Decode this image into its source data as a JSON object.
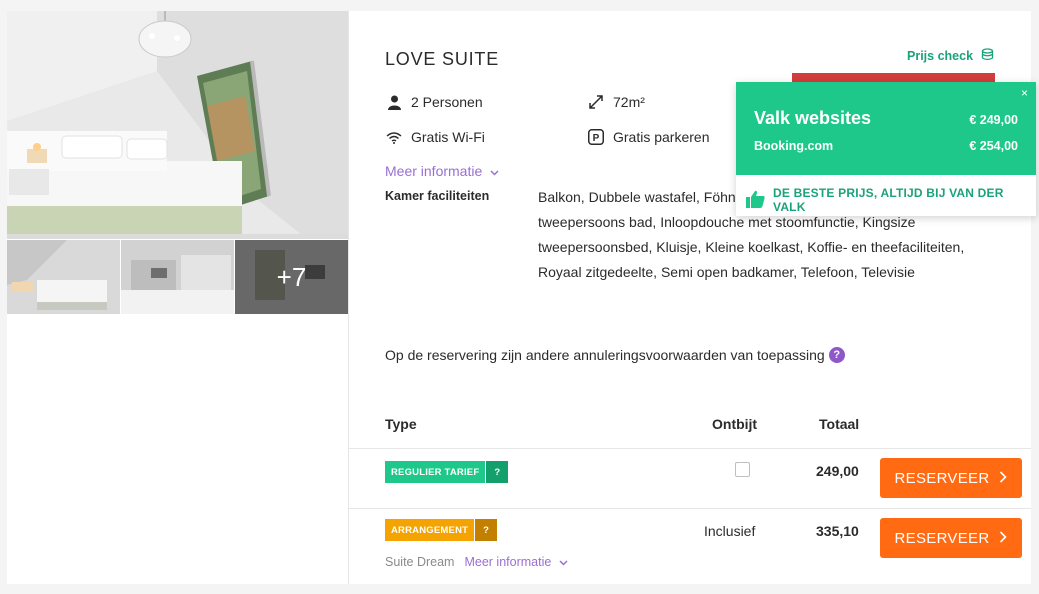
{
  "room": {
    "title": "LOVE SUITE",
    "features": {
      "persons": "2 Personen",
      "size": "72m²",
      "wifi": "Gratis Wi-Fi",
      "parking": "Gratis parkeren"
    },
    "more_info": "Meer informatie",
    "facilities_label": "Kamer faciliteiten",
    "facilities_text": "Balkon, Dubbele wastafel, Föhn, Bluetooth audio systeem, Groot tweepersoons bad, Inloopdouche met stoomfunctie, Kingsize tweepersoonsbed, Kluisje, Kleine koelkast, Koffie- en theefaciliteiten, Royaal zitgedeelte, Semi open badkamer, Telefoon, Televisie",
    "cancel_note": "Op de reservering zijn andere annuleringsvoorwaarden van toepassing",
    "more_photos": "+7"
  },
  "price_check": {
    "label": "Prijs check",
    "close": "×",
    "rows": [
      {
        "name": "Valk websites",
        "price": "€ 249,00"
      },
      {
        "name": "Booking.com",
        "price": "€ 254,00"
      }
    ],
    "footer": "DE BESTE PRIJS, ALTIJD BIJ VAN DER VALK"
  },
  "table": {
    "headers": {
      "type": "Type",
      "ontbijt": "Ontbijt",
      "totaal": "Totaal"
    },
    "rows": [
      {
        "badge": "REGULIER TARIEF",
        "badge_q": "?",
        "ontbijt": "",
        "totaal": "249,00",
        "button": "RESERVEER"
      },
      {
        "badge": "ARRANGEMENT",
        "badge_q": "?",
        "ontbijt": "Inclusief",
        "totaal": "335,10",
        "button": "RESERVEER",
        "sub_name": "Suite Dream",
        "sub_more": "Meer informatie"
      }
    ]
  },
  "colors": {
    "green": "#1ec88a",
    "orange_button": "#ff6a13",
    "purple_link": "#9a6fd1",
    "badge_orange": "#f5a300"
  }
}
